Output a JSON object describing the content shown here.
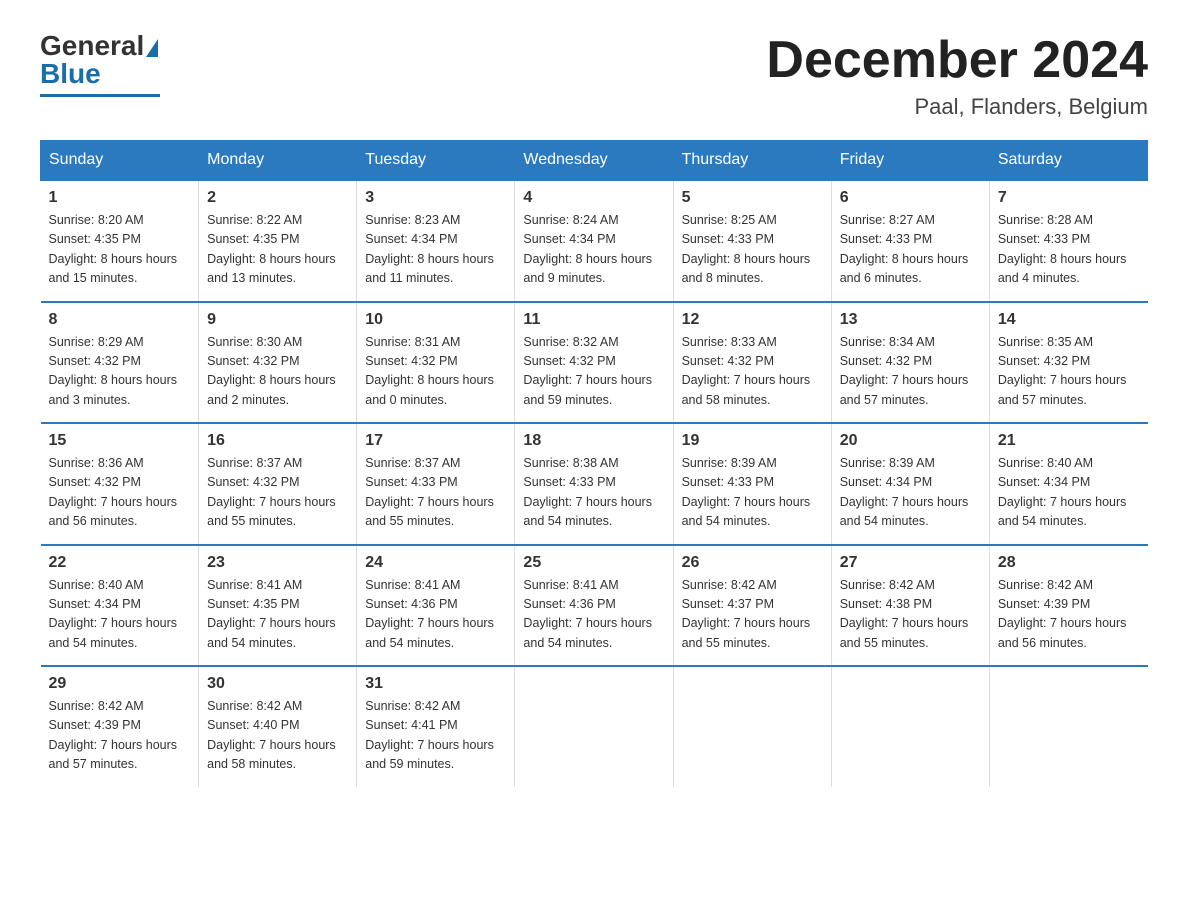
{
  "header": {
    "logo_general": "General",
    "logo_blue": "Blue",
    "month_title": "December 2024",
    "location": "Paal, Flanders, Belgium"
  },
  "weekdays": [
    "Sunday",
    "Monday",
    "Tuesday",
    "Wednesday",
    "Thursday",
    "Friday",
    "Saturday"
  ],
  "weeks": [
    [
      {
        "day": "1",
        "sunrise": "8:20 AM",
        "sunset": "4:35 PM",
        "daylight": "8 hours and 15 minutes."
      },
      {
        "day": "2",
        "sunrise": "8:22 AM",
        "sunset": "4:35 PM",
        "daylight": "8 hours and 13 minutes."
      },
      {
        "day": "3",
        "sunrise": "8:23 AM",
        "sunset": "4:34 PM",
        "daylight": "8 hours and 11 minutes."
      },
      {
        "day": "4",
        "sunrise": "8:24 AM",
        "sunset": "4:34 PM",
        "daylight": "8 hours and 9 minutes."
      },
      {
        "day": "5",
        "sunrise": "8:25 AM",
        "sunset": "4:33 PM",
        "daylight": "8 hours and 8 minutes."
      },
      {
        "day": "6",
        "sunrise": "8:27 AM",
        "sunset": "4:33 PM",
        "daylight": "8 hours and 6 minutes."
      },
      {
        "day": "7",
        "sunrise": "8:28 AM",
        "sunset": "4:33 PM",
        "daylight": "8 hours and 4 minutes."
      }
    ],
    [
      {
        "day": "8",
        "sunrise": "8:29 AM",
        "sunset": "4:32 PM",
        "daylight": "8 hours and 3 minutes."
      },
      {
        "day": "9",
        "sunrise": "8:30 AM",
        "sunset": "4:32 PM",
        "daylight": "8 hours and 2 minutes."
      },
      {
        "day": "10",
        "sunrise": "8:31 AM",
        "sunset": "4:32 PM",
        "daylight": "8 hours and 0 minutes."
      },
      {
        "day": "11",
        "sunrise": "8:32 AM",
        "sunset": "4:32 PM",
        "daylight": "7 hours and 59 minutes."
      },
      {
        "day": "12",
        "sunrise": "8:33 AM",
        "sunset": "4:32 PM",
        "daylight": "7 hours and 58 minutes."
      },
      {
        "day": "13",
        "sunrise": "8:34 AM",
        "sunset": "4:32 PM",
        "daylight": "7 hours and 57 minutes."
      },
      {
        "day": "14",
        "sunrise": "8:35 AM",
        "sunset": "4:32 PM",
        "daylight": "7 hours and 57 minutes."
      }
    ],
    [
      {
        "day": "15",
        "sunrise": "8:36 AM",
        "sunset": "4:32 PM",
        "daylight": "7 hours and 56 minutes."
      },
      {
        "day": "16",
        "sunrise": "8:37 AM",
        "sunset": "4:32 PM",
        "daylight": "7 hours and 55 minutes."
      },
      {
        "day": "17",
        "sunrise": "8:37 AM",
        "sunset": "4:33 PM",
        "daylight": "7 hours and 55 minutes."
      },
      {
        "day": "18",
        "sunrise": "8:38 AM",
        "sunset": "4:33 PM",
        "daylight": "7 hours and 54 minutes."
      },
      {
        "day": "19",
        "sunrise": "8:39 AM",
        "sunset": "4:33 PM",
        "daylight": "7 hours and 54 minutes."
      },
      {
        "day": "20",
        "sunrise": "8:39 AM",
        "sunset": "4:34 PM",
        "daylight": "7 hours and 54 minutes."
      },
      {
        "day": "21",
        "sunrise": "8:40 AM",
        "sunset": "4:34 PM",
        "daylight": "7 hours and 54 minutes."
      }
    ],
    [
      {
        "day": "22",
        "sunrise": "8:40 AM",
        "sunset": "4:34 PM",
        "daylight": "7 hours and 54 minutes."
      },
      {
        "day": "23",
        "sunrise": "8:41 AM",
        "sunset": "4:35 PM",
        "daylight": "7 hours and 54 minutes."
      },
      {
        "day": "24",
        "sunrise": "8:41 AM",
        "sunset": "4:36 PM",
        "daylight": "7 hours and 54 minutes."
      },
      {
        "day": "25",
        "sunrise": "8:41 AM",
        "sunset": "4:36 PM",
        "daylight": "7 hours and 54 minutes."
      },
      {
        "day": "26",
        "sunrise": "8:42 AM",
        "sunset": "4:37 PM",
        "daylight": "7 hours and 55 minutes."
      },
      {
        "day": "27",
        "sunrise": "8:42 AM",
        "sunset": "4:38 PM",
        "daylight": "7 hours and 55 minutes."
      },
      {
        "day": "28",
        "sunrise": "8:42 AM",
        "sunset": "4:39 PM",
        "daylight": "7 hours and 56 minutes."
      }
    ],
    [
      {
        "day": "29",
        "sunrise": "8:42 AM",
        "sunset": "4:39 PM",
        "daylight": "7 hours and 57 minutes."
      },
      {
        "day": "30",
        "sunrise": "8:42 AM",
        "sunset": "4:40 PM",
        "daylight": "7 hours and 58 minutes."
      },
      {
        "day": "31",
        "sunrise": "8:42 AM",
        "sunset": "4:41 PM",
        "daylight": "7 hours and 59 minutes."
      },
      null,
      null,
      null,
      null
    ]
  ],
  "labels": {
    "sunrise": "Sunrise:",
    "sunset": "Sunset:",
    "daylight": "Daylight:"
  }
}
